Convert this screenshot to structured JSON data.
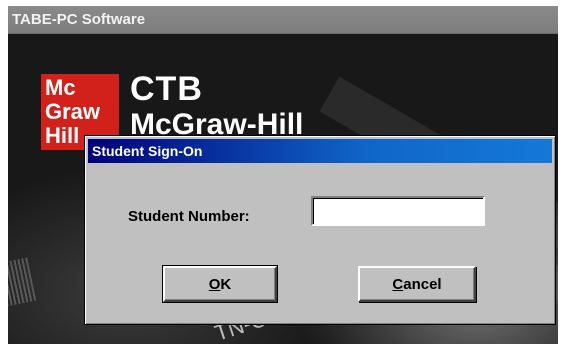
{
  "window": {
    "title": "TABE-PC Software"
  },
  "splash": {
    "logo_lines": [
      "Mc",
      "Graw",
      "Hill"
    ],
    "brand_primary": "CTB",
    "brand_secondary": "McGraw-Hill",
    "background_fragment": "TN-CB"
  },
  "dialog": {
    "title": "Student Sign-On",
    "student_number_label": "Student Number:",
    "student_number_value": "",
    "ok": {
      "accel": "O",
      "rest": "K"
    },
    "cancel": {
      "accel": "C",
      "rest": "ancel"
    }
  },
  "colors": {
    "logo_red": "#d2201a",
    "titlebar_blue": "#00007a",
    "dialog_gray": "#c0c0c0"
  }
}
